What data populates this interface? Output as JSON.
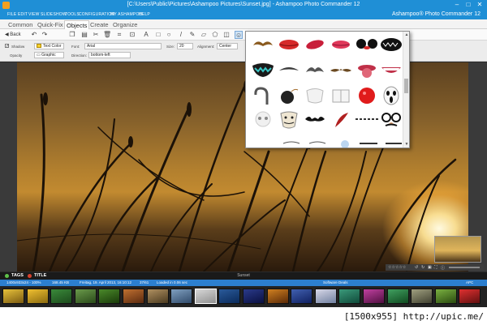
{
  "window": {
    "title": "[C:\\Users\\Public\\Pictures\\Ashampoo Pictures\\Sunset.jpg] - Ashampoo Photo Commander 12",
    "controls": [
      "–",
      "□",
      "✕"
    ]
  },
  "menu": {
    "items": [
      "FILE",
      "EDIT",
      "VIEW",
      "SLIDESHOW",
      "TOOLS",
      "CONFIGURATION",
      "MY ASHAMPOO",
      "HELP"
    ],
    "brand": "Ashampoo® Photo Commander 12"
  },
  "tabs": [
    "Common",
    "Quick-Fix",
    "Objects",
    "Create",
    "Organize"
  ],
  "active_tab": "Objects",
  "toolbar": {
    "back_label": "Back",
    "icons": [
      "undo-icon",
      "redo-icon",
      "copy-icon",
      "cut-icon",
      "delete-icon",
      "crop-icon",
      "transform-icon",
      "text-icon",
      "rectangle-icon",
      "ellipse-icon",
      "line-icon",
      "pen-icon",
      "stamp-icon",
      "clipart-icon",
      "layers-icon",
      "clipart-active-icon"
    ]
  },
  "properties": {
    "shadow_label": "Shadow",
    "text_color_label": "Text Color",
    "opacity_label": "Opacity",
    "graphic_label": "Graphic",
    "font_label": "Font:",
    "font_value": "Arial",
    "size_label": "Size:",
    "size_value": "20",
    "alignment_label": "Alignment:",
    "alignment_value": "Center",
    "direction_label": "Direction:",
    "direction_value": "bottom-left"
  },
  "clipart": {
    "rows": [
      [
        "mustache-1",
        "lips-red",
        "lips-red-2",
        "lips-red-3",
        "mouse-ears",
        "monster-mouth"
      ],
      [
        "teeth-green",
        "mustache-2",
        "mustache-3",
        "mustache-4",
        "tongue",
        "teeth-smile"
      ],
      [
        "hook-hand",
        "bomb",
        "white-mask",
        "book",
        "clown-nose",
        "scream-mask"
      ],
      [
        "skull",
        "guy-fawkes-mask",
        "bat",
        "feather",
        "chain",
        "glasses-nose"
      ]
    ]
  },
  "tags_bar": {
    "tags_label": "TAGS",
    "title_label": "TITLE",
    "title_value": "Sunset"
  },
  "status": {
    "dimensions": "1400x933x24 - 100%",
    "file_size": "168.45 KB",
    "date": "Freitag, 19. April 2013, 16:10:12",
    "index": "37/61",
    "load_time": "Loaded in 0.06 sec",
    "deals": "Software Deals",
    "apc": "APC"
  },
  "filmstrip": {
    "count": 20,
    "selected_index": 8
  },
  "watermark": "[1500x955] http://upic.me/",
  "colors": {
    "accent": "#1f8fd6",
    "status": "#2c7fcf"
  }
}
